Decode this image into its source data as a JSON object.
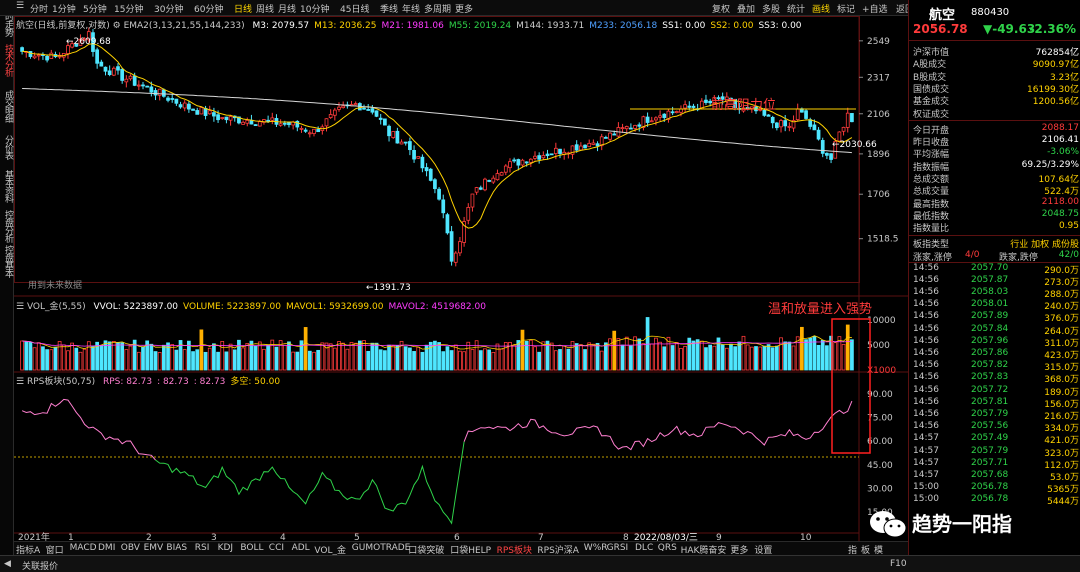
{
  "topbar": {
    "periods": [
      "分时",
      "1分钟",
      "5分钟",
      "15分钟",
      "30分钟",
      "60分钟",
      "日线",
      "周线",
      "月线",
      "10分钟",
      "45日线",
      "季线",
      "年线",
      "多周期",
      "更多"
    ],
    "active_period": "日线",
    "right_buttons": [
      "复权",
      "叠加",
      "多股",
      "统计",
      "画线",
      "标记",
      "+自选",
      "返回"
    ],
    "highlight_button": "画线"
  },
  "left_tabs": [
    "分时走势",
    "技术分析",
    "成交明细",
    "分价表",
    "基本资料",
    "控盘分析",
    "控盘基本"
  ],
  "left_tab_active": "技术分析",
  "main_legend": {
    "title": "航空(日线,前复权,对数)",
    "ema": "EMA2(3,13,21,55,144,233)",
    "items": [
      {
        "text": "M3: 2079.57",
        "color": "#ffffff"
      },
      {
        "text": "M13: 2036.25",
        "color": "#ffd200"
      },
      {
        "text": "M21: 1981.06",
        "color": "#ff3cff"
      },
      {
        "text": "M55: 2019.24",
        "color": "#2fd34a"
      },
      {
        "text": "M144: 1933.71",
        "color": "#cccccc"
      },
      {
        "text": "M233: 2056.18",
        "color": "#4fa0ff"
      },
      {
        "text": "SS1: 0.00",
        "color": "#ffffff"
      },
      {
        "text": "SS2: 0.00",
        "color": "#ffd200"
      },
      {
        "text": "SS3: 0.00",
        "color": "#ffffff"
      }
    ]
  },
  "price_axis": [
    "2549",
    "2317",
    "2106",
    "1896",
    "1706",
    "1518.5"
  ],
  "price_marks": {
    "high": "2609.68",
    "low": "1391.73",
    "last": "2030.66"
  },
  "future_data_note": "用到未来数据",
  "vol_legend": {
    "title": "VOL_金(5,55)",
    "items": [
      {
        "text": "VVOL: 5223897.00",
        "color": "#ffffff"
      },
      {
        "text": "VOLUME: 5223897.00",
        "color": "#ffd200"
      },
      {
        "text": "MAVOL1: 5932699.00",
        "color": "#ffd200"
      },
      {
        "text": "MAVOL2: 4519682.00",
        "color": "#ff3cff"
      }
    ]
  },
  "vol_axis": [
    "10000",
    "5000",
    "X1000"
  ],
  "rps_legend": {
    "title": "RPS板块(50,75)",
    "items": [
      {
        "text": "RPS: 82.73",
        "color": "#ff7fd0"
      },
      {
        "text": ": 82.73",
        "color": "#ff7fd0"
      },
      {
        "text": ": 82.73",
        "color": "#ff7fd0"
      },
      {
        "text": "多空: 50.00",
        "color": "#ffd200"
      }
    ]
  },
  "rps_axis": [
    "90.00",
    "75.00",
    "60.00",
    "45.00",
    "30.00",
    "15.00"
  ],
  "date_axis": [
    "2021年",
    "1",
    "2",
    "3",
    "4",
    "5",
    "6",
    "7",
    "8",
    "9",
    "10"
  ],
  "crosshair_date": "2022/08/03/三",
  "annotations": {
    "resistance": "前高阻力位",
    "volume": "温和放量进入强势"
  },
  "bottom_tabs": [
    "指标A",
    "窗口",
    "MACD",
    "DMI",
    "OBV",
    "EMV",
    "BIAS",
    "RSI",
    "KDJ",
    "BOLL",
    "CCI",
    "ADL",
    "VOL_金",
    "GUMOTRADE",
    "口袋突破",
    "口袋HELP",
    "RPS板块",
    "RPS沪深A",
    "W%R",
    "GRSI",
    "DLC",
    "QRS",
    "HAK腾奋安",
    "更多",
    "设置"
  ],
  "bottom_active": "RPS板块",
  "bottom_right": [
    "指",
    "板",
    "模"
  ],
  "status": {
    "left": "关联报价",
    "right": "F10"
  },
  "panel": {
    "name": "航空",
    "code": "880430",
    "price": "2056.78",
    "change": "▼-49.63",
    "pct": "-2.36%",
    "stats1": [
      {
        "k": "沪深市值",
        "v": "762854亿",
        "c": "white"
      },
      {
        "k": "A股成交",
        "v": "9090.97亿",
        "c": "yellow"
      },
      {
        "k": "B股成交",
        "v": "3.23亿",
        "c": "yellow"
      },
      {
        "k": "国债成交",
        "v": "16199.30亿",
        "c": "yellow"
      },
      {
        "k": "基金成交",
        "v": "1200.56亿",
        "c": "yellow"
      },
      {
        "k": "权证成交",
        "v": "",
        "c": "yellow"
      }
    ],
    "stats2": [
      {
        "k": "今日开盘",
        "v": "2088.17",
        "c": "red"
      },
      {
        "k": "昨日收盘",
        "v": "2106.41",
        "c": "white"
      },
      {
        "k": "平均涨幅",
        "v": "-3.06%",
        "c": "green"
      },
      {
        "k": "指数振幅",
        "v": "69.25/3.29%",
        "c": "white"
      },
      {
        "k": "总成交额",
        "v": "107.64亿",
        "c": "yellow"
      },
      {
        "k": "总成交量",
        "v": "522.4万",
        "c": "yellow"
      },
      {
        "k": "最高指数",
        "v": "2118.00",
        "c": "red"
      },
      {
        "k": "最低指数",
        "v": "2048.75",
        "c": "green"
      },
      {
        "k": "指数量比",
        "v": "0.95",
        "c": "yellow"
      }
    ],
    "sector": {
      "k": "板指类型",
      "v": "行业 加权 成份股"
    },
    "updown": {
      "k1": "涨家,涨停",
      "v1": "4/0",
      "k2": "跌家,跌停",
      "v2": "42/0"
    },
    "ticks": [
      [
        "14:56",
        "2057.70",
        "290.0万"
      ],
      [
        "14:56",
        "2057.87",
        "273.0万"
      ],
      [
        "14:56",
        "2058.03",
        "288.0万"
      ],
      [
        "14:56",
        "2058.01",
        "240.0万"
      ],
      [
        "14:56",
        "2057.89",
        "376.0万"
      ],
      [
        "14:56",
        "2057.84",
        "264.0万"
      ],
      [
        "14:56",
        "2057.96",
        "311.0万"
      ],
      [
        "14:56",
        "2057.86",
        "423.0万"
      ],
      [
        "14:56",
        "2057.82",
        "315.0万"
      ],
      [
        "14:56",
        "2057.83",
        "368.0万"
      ],
      [
        "14:56",
        "2057.72",
        "189.0万"
      ],
      [
        "14:56",
        "2057.81",
        "156.0万"
      ],
      [
        "14:56",
        "2057.79",
        "216.0万"
      ],
      [
        "14:56",
        "2057.56",
        "334.0万"
      ],
      [
        "14:57",
        "2057.49",
        "421.0万"
      ],
      [
        "14:57",
        "2057.79",
        "323.0万"
      ],
      [
        "14:57",
        "2057.71",
        "112.0万"
      ],
      [
        "14:57",
        "2057.68",
        "53.0万"
      ],
      [
        "15:00",
        "2056.78",
        "5365万"
      ],
      [
        "15:00",
        "2056.78",
        "5444万"
      ]
    ]
  },
  "watermark": "趋势一阳指",
  "colors": {
    "up": "#ff3b3b",
    "down": "#4fe6ff",
    "ma13": "#ffd200",
    "ma144": "#d8d8d8",
    "rps_high": "#ff7fd0",
    "rps_low": "#2fd34a",
    "annot": "#ff3b3b"
  }
}
